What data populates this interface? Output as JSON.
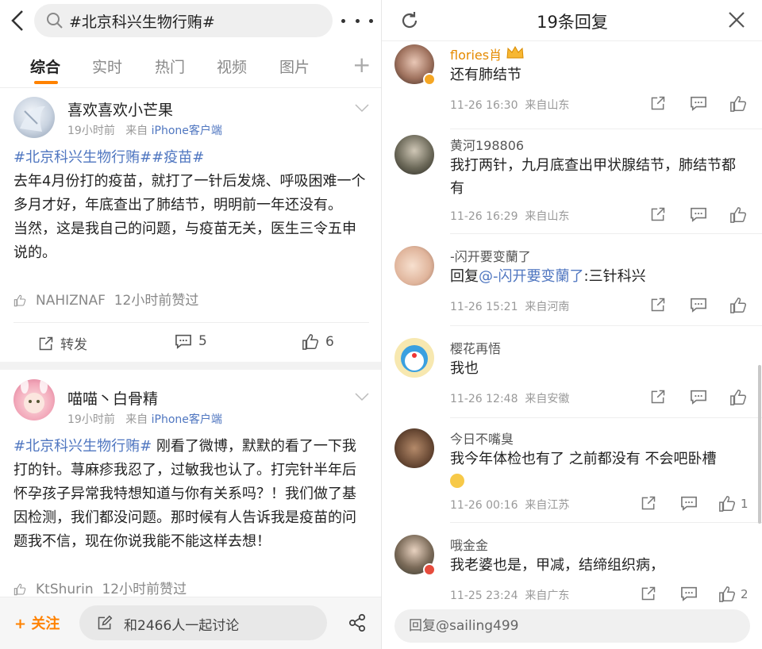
{
  "left": {
    "search": {
      "value": "#北京科兴生物行贿#"
    },
    "tabs": [
      {
        "label": "综合",
        "active": true
      },
      {
        "label": "实时"
      },
      {
        "label": "热门"
      },
      {
        "label": "视频"
      },
      {
        "label": "图片"
      }
    ],
    "posts": [
      {
        "username": "喜欢喜欢小芒果",
        "time": "19小时前",
        "from_prefix": "来自",
        "source": "iPhone客户端",
        "hashtags": "#北京科兴生物行贿##疫苗#",
        "text": "去年4月份打的疫苗，就打了一针后发烧、呼吸困难一个多月才好，年底查出了肺结节，明明前一年还没有。\n当然，这是我自己的问题，与疫苗无关，医生三令五申说的。",
        "liked_by": "NAHIZNAF",
        "liked_time": "12小时前赞过",
        "repost_label": "转发",
        "comments": "5",
        "likes": "6"
      },
      {
        "username": "喵喵丶白骨精",
        "time": "19小时前",
        "from_prefix": "来自",
        "source": "iPhone客户端",
        "hashtags": "#北京科兴生物行贿#",
        "text": " 刚看了微博，默默的看了一下我打的针。荨麻疹我忍了，过敏我也认了。打完针半年后怀孕孩子异常我特想知道与你有关系吗？！我们做了基因检测，我们都没问题。那时候有人告诉我是疫苗的问题我不信，现在你说我能不能这样去想！",
        "liked_by": "KtShurin",
        "liked_time": "12小时前赞过"
      }
    ],
    "bottom": {
      "follow_label": "+ 关注",
      "discuss_label": "和2466人一起讨论"
    }
  },
  "right": {
    "title": "19条回复",
    "replies": [
      {
        "name": "flories肖",
        "text": "还有肺结节",
        "time": "11-26 16:30",
        "location": "来自山东",
        "likes": ""
      },
      {
        "name": "黄河198806",
        "text": "我打两针，九月底查出甲状腺结节，肺结节都有",
        "time": "11-26 16:29",
        "location": "来自山东",
        "likes": ""
      },
      {
        "name": "-闪开要变蘭了",
        "reply_prefix": "回复",
        "mention": "@-闪开要变蘭了",
        "text": ":三针科兴",
        "time": "11-26 15:21",
        "location": "来自河南",
        "likes": ""
      },
      {
        "name": "樱花再悟",
        "text": "我也",
        "time": "11-26 12:48",
        "location": "来自安徽",
        "likes": ""
      },
      {
        "name": "今日不嘴臭",
        "text": "我今年体检也有了 之前都没有 不会吧卧槽",
        "time": "11-26 00:16",
        "location": "来自江苏",
        "likes": "1"
      },
      {
        "name": "哦金金",
        "text": "我老婆也是，甲减，结缔组织病，",
        "time": "11-25 23:24",
        "location": "来自广东",
        "likes": "2"
      }
    ],
    "input_placeholder": "回复@sailing499"
  },
  "colors": {
    "accent": "#ff8200",
    "link": "#4f76c0",
    "gold_name": "#e58a00"
  },
  "icons": [
    "back-arrow-icon",
    "search-icon",
    "more-icon",
    "plus-icon",
    "chevron-down-icon",
    "thumb-up-icon",
    "repost-icon",
    "comment-icon",
    "edit-icon",
    "share-icon",
    "refresh-icon",
    "close-icon",
    "crown-icon",
    "verified-badge-icon"
  ]
}
